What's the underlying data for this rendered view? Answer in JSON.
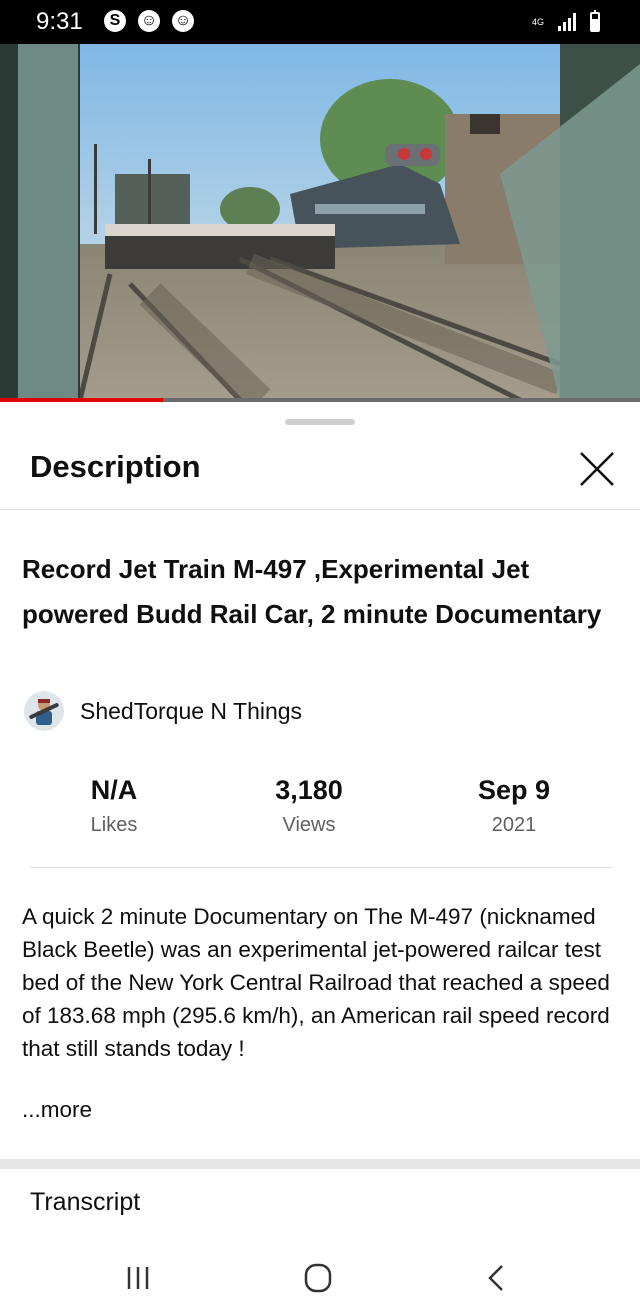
{
  "status_bar": {
    "time": "9:31",
    "app_icons": [
      "S",
      "☺",
      "☺"
    ],
    "network_label": "4G",
    "icon_names": [
      "notification-app-icon",
      "smiley-icon",
      "smiley-icon",
      "signal-icon",
      "battery-icon"
    ]
  },
  "video": {
    "progress_fraction": 0.255
  },
  "description_panel": {
    "title": "Description",
    "close_icon": "close-icon"
  },
  "video_info": {
    "title": "Record Jet Train M-497 ,Experimental Jet powered Budd Rail Car, 2 minute Documentary",
    "channel_name": "ShedTorque N Things",
    "stats": [
      {
        "value": "N/A",
        "label": "Likes"
      },
      {
        "value": "3,180",
        "label": "Views"
      },
      {
        "value": "Sep 9",
        "label": "2021"
      }
    ],
    "description": "A quick 2 minute Documentary on The M-497 (nicknamed Black Beetle) was an experimental jet-powered railcar test bed of the New York Central Railroad that reached a speed of 183.68 mph (295.6 km/h), an American rail speed record that still stands today !",
    "more_label": "...more"
  },
  "transcript": {
    "label": "Transcript"
  },
  "nav_bar": {
    "icons": [
      "recent-apps-icon",
      "home-icon",
      "back-icon"
    ]
  },
  "colors": {
    "progress": "#e00000",
    "accent_text": "#0f0f0f",
    "secondary_text": "#606060"
  }
}
